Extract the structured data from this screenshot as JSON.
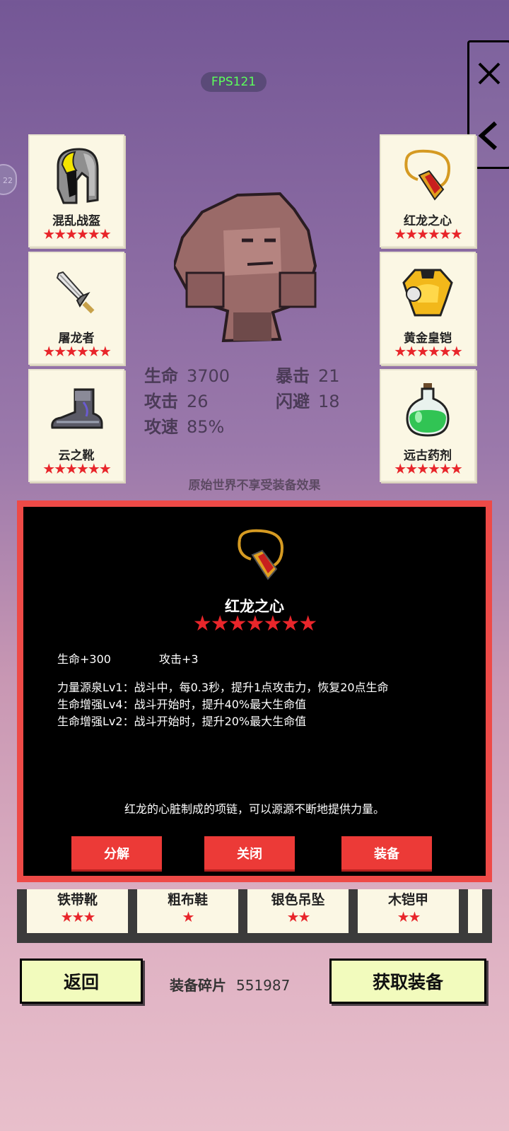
{
  "fps": "FPS121",
  "left_bubble": "22",
  "equipment": {
    "helmet": {
      "name": "混乱战盔",
      "stars": "★★★★★★"
    },
    "weapon": {
      "name": "屠龙者",
      "stars": "★★★★★★"
    },
    "boots": {
      "name": "云之靴",
      "stars": "★★★★★★"
    },
    "necklace": {
      "name": "红龙之心",
      "stars": "★★★★★★"
    },
    "armor": {
      "name": "黄金皇铠",
      "stars": "★★★★★★"
    },
    "potion": {
      "name": "远古药剂",
      "stars": "★★★★★★"
    }
  },
  "stats": {
    "hp_label": "生命",
    "hp": "3700",
    "crit_label": "暴击",
    "crit": "21",
    "atk_label": "攻击",
    "atk": "26",
    "dodge_label": "闪避",
    "dodge": "18",
    "speed_label": "攻速",
    "speed": "85%"
  },
  "note": "原始世界不享受装备效果",
  "dialog": {
    "title": "红龙之心",
    "stars": "★★★★★★★",
    "attr1": "生命+300",
    "attr2": "攻击+3",
    "skill1": "力量源泉Lv1：战斗中，每0.3秒，提升1点攻击力，恢复20点生命",
    "skill2": "生命增强Lv4：战斗开始时，提升40%最大生命值",
    "skill3": "生命增强Lv2：战斗开始时，提升20%最大生命值",
    "flavor": "红龙的心脏制成的项链，可以源源不断地提供力量。",
    "btn_decompose": "分解",
    "btn_close": "关闭",
    "btn_equip": "装备"
  },
  "inventory": [
    {
      "name": "铁带靴",
      "stars": "★★★"
    },
    {
      "name": "粗布鞋",
      "stars": "★"
    },
    {
      "name": "银色吊坠",
      "stars": "★★"
    },
    {
      "name": "木铠甲",
      "stars": "★★"
    }
  ],
  "footer": {
    "back": "返回",
    "shards_label": "装备碎片",
    "shards_value": "551987",
    "get_equipment": "获取装备"
  },
  "colors": {
    "star": "#e8252a",
    "dialog_border": "#ee4a47",
    "button_red": "#ec3a37",
    "fps_text": "#5cff5c"
  }
}
